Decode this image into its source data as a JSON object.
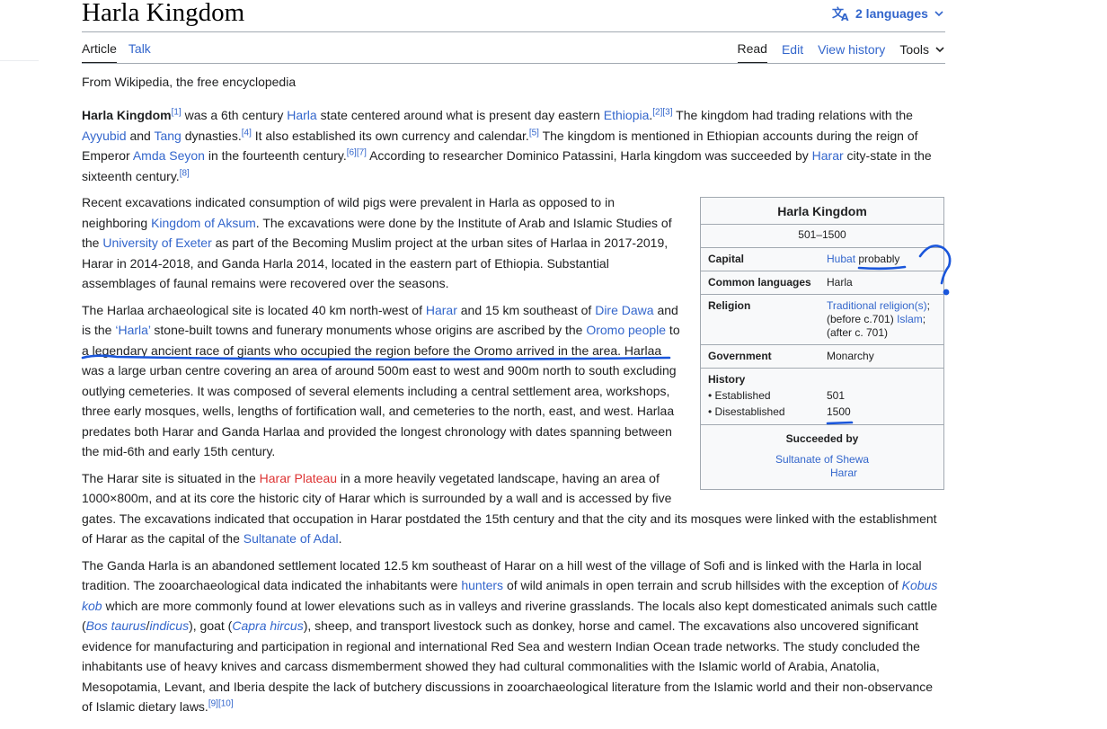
{
  "page": {
    "title": "Harla Kingdom",
    "languages_label": "2 languages",
    "tagline": "From Wikipedia, the free encyclopedia"
  },
  "tabs": {
    "left": [
      "Article",
      "Talk"
    ],
    "right": [
      "Read",
      "Edit",
      "View history"
    ],
    "tools_label": "Tools"
  },
  "infobox": {
    "title": "Harla Kingdom",
    "years": "501–1500",
    "capital_label": "Capital",
    "capital_link": "Hubat",
    "capital_note": "probably",
    "languages_label": "Common languages",
    "languages_value": "Harla",
    "religion_label": "Religion",
    "religion_link1": "Traditional religion(s)",
    "religion_text1": "; (before c.701)",
    "religion_link2": "Islam",
    "religion_text2": "; (after c. 701)",
    "government_label": "Government",
    "government_value": "Monarchy",
    "history_label": "History",
    "established_label": "• Established",
    "established_value": "501",
    "disestablished_label": "• Disestablished",
    "disestablished_value": "1500",
    "succeeded_label": "Succeeded by",
    "succeeded_1": "Sultanate of Shewa",
    "succeeded_2": "Harar"
  },
  "p1": {
    "b0": "Harla Kingdom",
    "r1": "[1]",
    "t1": " was a 6th century ",
    "l1": "Harla",
    "t2": " state centered around what is present day eastern ",
    "l2": "Ethiopia",
    "t3": ".",
    "r2": "[2][3]",
    "t4": " The kingdom had trading relations with the ",
    "l3": "Ayyubid",
    "t5": " and ",
    "l4": "Tang",
    "t6": " dynasties.",
    "r3": "[4]",
    "t7": " It also established its own currency and calendar.",
    "r4": "[5]",
    "t8": " The kingdom is mentioned in Ethiopian accounts during the reign of Emperor ",
    "l5": "Amda Seyon",
    "t9": " in the fourteenth century.",
    "r5": "[6][7]",
    "t10": " According to researcher Dominico Patassini, Harla kingdom was succeeded by ",
    "l6": "Harar",
    "t11": " city-state in the sixteenth century.",
    "r6": "[8]"
  },
  "p2": {
    "t1": "Recent excavations indicated consumption of wild pigs were prevalent in Harla as opposed to in neighboring ",
    "l1": "Kingdom of Aksum",
    "t2": ". The excavations were done by the Institute of Arab and Islamic Studies of the ",
    "l2": "University of Exeter",
    "t3": " as part of the Becoming Muslim project at the urban sites of Harlaa in 2017-2019, Harar in 2014-2018, and Ganda Harla 2014, located in the eastern part of Ethiopia. Substantial assemblages of faunal remains were recovered over the seasons."
  },
  "p3": {
    "t1": "The Harlaa archaeological site is located 40 km north-west of ",
    "l1": "Harar",
    "t2": " and 15 km southeast of ",
    "l2": "Dire Dawa",
    "t3": " and is the ",
    "l3": "‘Harla’",
    "t4": " stone-built towns and funerary monuments whose origins are ascribed by the ",
    "l4": "Oromo people",
    "t5": " to a legendary ancient race of giants who occupied the region before the Oromo arrived in the area. Harlaa was a large urban centre covering an area of around 500m east to west and 900m north to south excluding outlying cemeteries. It was composed of several elements including a central settlement area, workshops, three early mosques, wells, lengths of fortification wall, and cemeteries to the north, east, and west. Harlaa predates both Harar and Ganda Harlaa and provided the longest chronology with dates spanning between the mid-6th and early 15th century."
  },
  "p4": {
    "t1": "The Harar site is situated in the ",
    "l1": "Harar Plateau",
    "t2": " in a more heavily vegetated landscape, having an area of 1000×800m, and at its core the historic city of Harar which is surrounded by a wall and is accessed by five gates. The excavations indicated that occupation in Harar postdated the 15th century and that the city and its mosques were linked with the establishment of Harar as the capital of the ",
    "l2": "Sultanate of Adal",
    "t3": "."
  },
  "p5": {
    "t1": "The Ganda Harla is an abandoned settlement located 12.5 km southeast of Harar on a hill west of the village of Sofi and is linked with the Harla in local tradition. The zooarchaeological data indicated the inhabitants were ",
    "l1": "hunters",
    "t2": " of wild animals in open terrain and scrub hillsides with the exception of ",
    "l2": "Kobus kob",
    "t3": " which are more commonly found at lower elevations such as in valleys and riverine grasslands. The locals also kept domesticated animals such cattle (",
    "l3": "Bos taurus",
    "t4": "/",
    "l4": "indicus",
    "t5": "), goat (",
    "l5": "Capra hircus",
    "t6": "), sheep, and transport livestock such as donkey, horse and camel. The excavations also uncovered significant evidence for manufacturing and participation in regional and international Red Sea and western Indian Ocean trade networks. The study concluded the inhabitants use of heavy knives and carcass dismemberment showed they had cultural commonalities with the Islamic world of Arabia, Anatolia, Mesopotamia, Levant, and Iberia despite the lack of butchery discussions in zooarchaeological literature from the Islamic world and their non-observance of Islamic dietary laws.",
    "r1": "[9][10]"
  },
  "annotation": {
    "symbol": "?",
    "color": "#1a56db"
  }
}
